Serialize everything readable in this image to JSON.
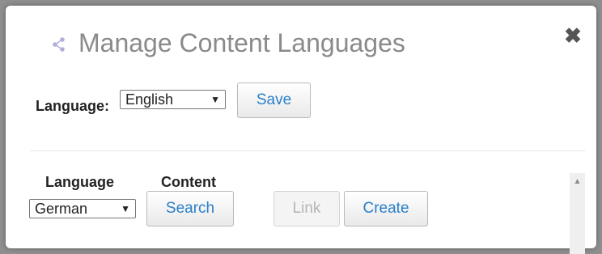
{
  "dialog": {
    "title": "Manage Content Languages",
    "icons": {
      "title_icon": "share-icon",
      "close": "close-icon"
    },
    "close_glyph": "✖"
  },
  "language_row": {
    "label": "Language:",
    "selected_value": "English",
    "save_label": "Save"
  },
  "table": {
    "headers": {
      "language": "Language",
      "content": "Content"
    },
    "rows": [
      {
        "language_value": "German",
        "search_label": "Search",
        "link_label": "Link",
        "create_label": "Create"
      }
    ]
  },
  "colors": {
    "accent": "#2a7fc9",
    "title": "#8a8a8a",
    "disabled": "#b5b5b5"
  }
}
